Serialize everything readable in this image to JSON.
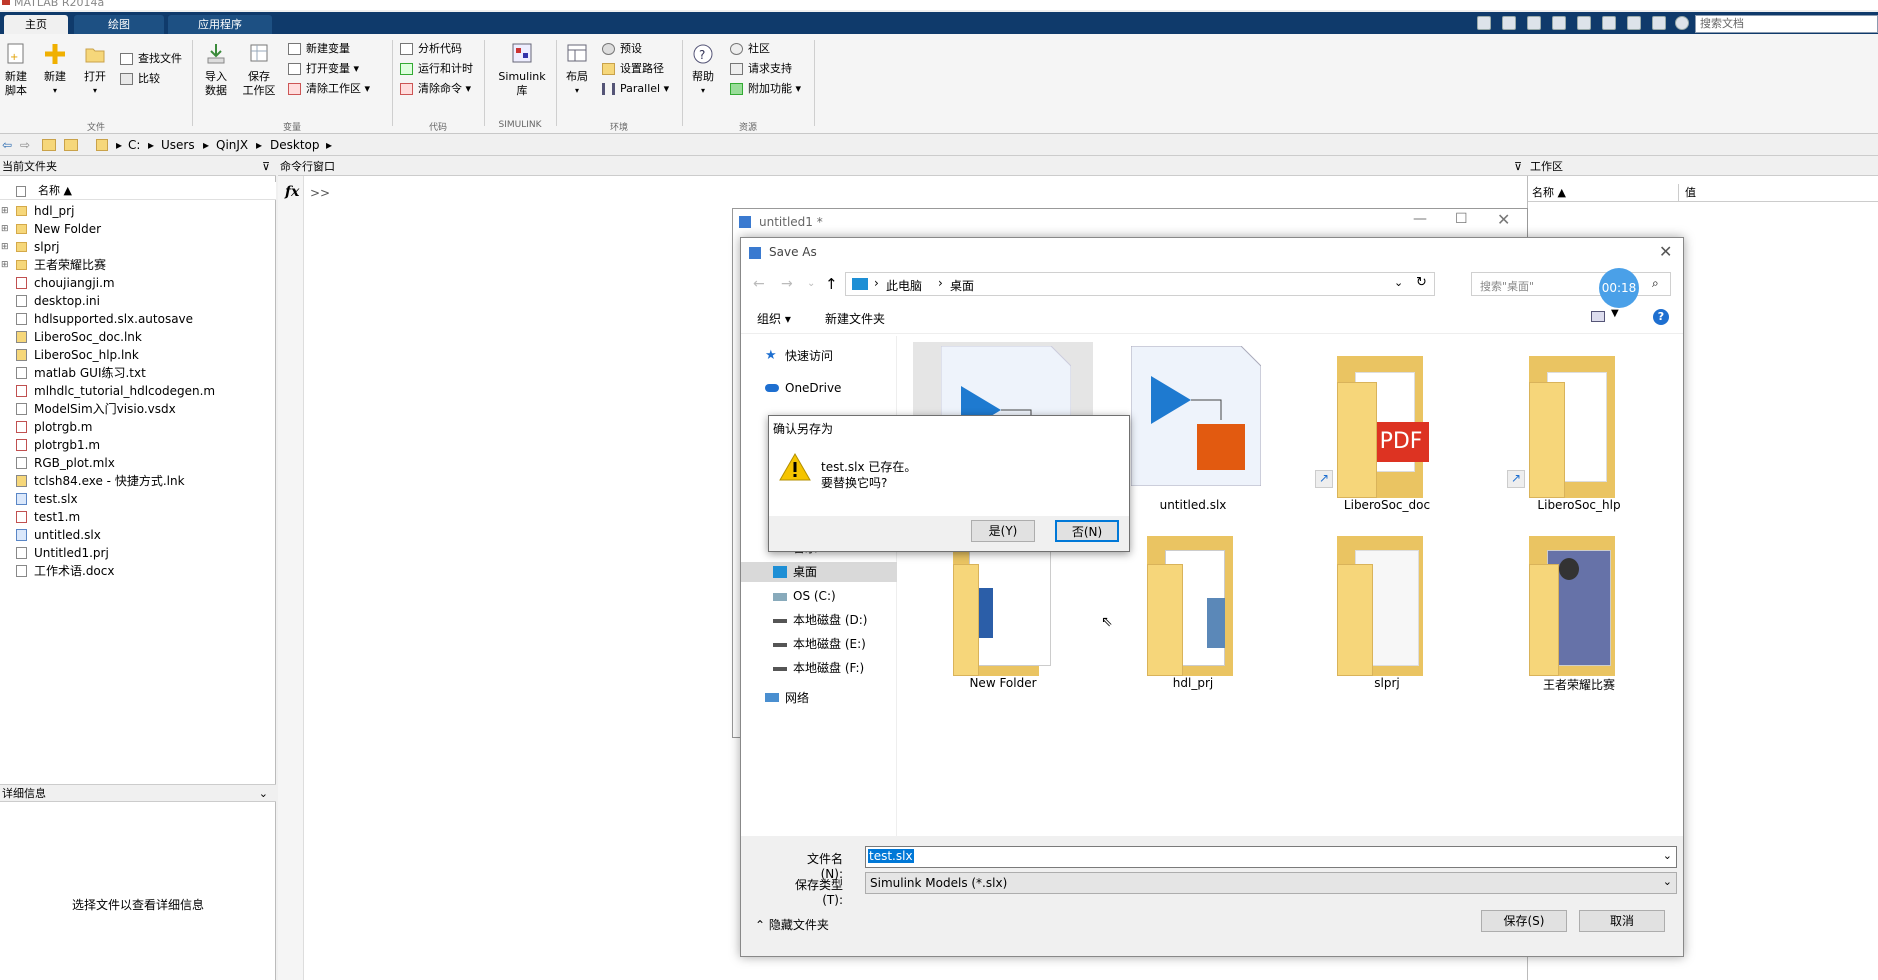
{
  "app": {
    "title": "MATLAB R2014a"
  },
  "tabs": [
    "主页",
    "绘图",
    "应用程序"
  ],
  "search_doc": {
    "placeholder": "搜索文档"
  },
  "ribbon": {
    "new_script": "新建\n脚本",
    "new": "新建",
    "open": "打开",
    "find_files": "查找文件",
    "compare": "比较",
    "import_data": "导入\n数据",
    "save_workspace": "保存\n工作区",
    "new_var": "新建变量",
    "open_var": "打开变量",
    "clear_workspace": "清除工作区",
    "analyze_code": "分析代码",
    "run_time": "运行和计时",
    "clear_commands": "清除命令",
    "simulink": "Simulink\n库",
    "layout": "布局",
    "preferences": "预设",
    "set_path": "设置路径",
    "parallel": "Parallel",
    "help": "帮助",
    "community": "社区",
    "request_support": "请求支持",
    "addons": "附加功能",
    "groups": {
      "file": "文件",
      "variable": "变量",
      "code": "代码",
      "simulink": "SIMULINK",
      "env": "环境",
      "resources": "资源"
    }
  },
  "address": {
    "crumbs": [
      "C:",
      "Users",
      "QinJX",
      "Desktop"
    ]
  },
  "current_folder": {
    "title": "当前文件夹",
    "col_name": "名称 ▲",
    "files": [
      {
        "name": "hdl_prj",
        "type": "folder"
      },
      {
        "name": "New Folder",
        "type": "folder"
      },
      {
        "name": "slprj",
        "type": "folder"
      },
      {
        "name": "王者荣耀比赛",
        "type": "folder"
      },
      {
        "name": "choujiangji.m",
        "type": "m"
      },
      {
        "name": "desktop.ini",
        "type": "file"
      },
      {
        "name": "hdlsupported.slx.autosave",
        "type": "file"
      },
      {
        "name": "LiberoSoc_doc.lnk",
        "type": "lnk"
      },
      {
        "name": "LiberoSoc_hlp.lnk",
        "type": "lnk"
      },
      {
        "name": "matlab GUI练习.txt",
        "type": "file"
      },
      {
        "name": "mlhdlc_tutorial_hdlcodegen.m",
        "type": "m"
      },
      {
        "name": "ModelSim入门visio.vsdx",
        "type": "file"
      },
      {
        "name": "plotrgb.m",
        "type": "m"
      },
      {
        "name": "plotrgb1.m",
        "type": "m"
      },
      {
        "name": "RGB_plot.mlx",
        "type": "file"
      },
      {
        "name": "tclsh84.exe - 快捷方式.lnk",
        "type": "lnk"
      },
      {
        "name": "test.slx",
        "type": "slx"
      },
      {
        "name": "test1.m",
        "type": "m"
      },
      {
        "name": "untitled.slx",
        "type": "slx"
      },
      {
        "name": "Untitled1.prj",
        "type": "file"
      },
      {
        "name": "工作术语.docx",
        "type": "file"
      }
    ],
    "details_title": "详细信息",
    "details_msg": "选择文件以查看详细信息"
  },
  "command_window": {
    "title": "命令行窗口",
    "prompt": ">>",
    "fx": "fx"
  },
  "workspace": {
    "title": "工作区",
    "col_name": "名称 ▲",
    "col_value": "值"
  },
  "untitled_window": {
    "title": "untitled1 *"
  },
  "save_as": {
    "title": "Save As",
    "path": [
      "此电脑",
      "桌面"
    ],
    "search_placeholder": "搜索\"桌面\"",
    "timer": "00:18",
    "organize": "组织 ▾",
    "new_folder": "新建文件夹",
    "nav": [
      "快速访问",
      "OneDrive",
      "音乐",
      "桌面",
      "OS (C:)",
      "本地磁盘 (D:)",
      "本地磁盘 (E:)",
      "本地磁盘 (F:)",
      "网络"
    ],
    "tiles": [
      "",
      "untitled.slx",
      "LiberoSoc_doc",
      "LiberoSoc_hlp",
      "New Folder",
      "hdl_prj",
      "slprj",
      "王者荣耀比赛"
    ],
    "filename_label": "文件名(N):",
    "filename_value": "test.slx",
    "filetype_label": "保存类型(T):",
    "filetype_value": "Simulink Models (*.slx)",
    "hide_folders": "隐藏文件夹",
    "save": "保存(S)",
    "cancel": "取消"
  },
  "confirm": {
    "title": "确认另存为",
    "line1": "test.slx 已存在。",
    "line2": "要替换它吗?",
    "yes": "是(Y)",
    "no": "否(N)"
  }
}
